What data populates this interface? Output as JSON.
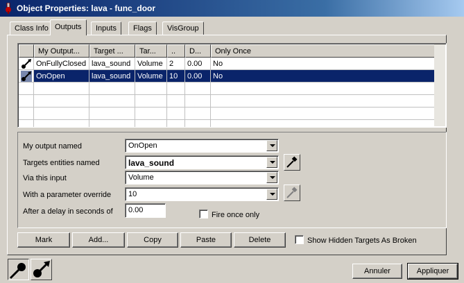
{
  "window": {
    "title": "Object Properties: lava - func_door"
  },
  "tabs": [
    {
      "label": "Class Info"
    },
    {
      "label": "Outputs",
      "active": true
    },
    {
      "label": "Inputs"
    },
    {
      "label": "Flags"
    },
    {
      "label": "VisGroup"
    }
  ],
  "grid": {
    "columns": [
      "My Output...",
      "Target ...",
      "Tar...",
      "..",
      "D...",
      "Only Once"
    ],
    "rows": [
      {
        "output": "OnFullyClosed",
        "target": "lava_sound",
        "input": "Volume",
        "param": "2",
        "delay": "0.00",
        "once": "No",
        "icon": "output-connection-icon"
      },
      {
        "output": "OnOpen",
        "target": "lava_sound",
        "input": "Volume",
        "param": "10",
        "delay": "0.00",
        "once": "No",
        "icon": "output-connection-icon",
        "selected": true
      }
    ]
  },
  "form": {
    "output_label": "My output named",
    "output_value": "OnOpen",
    "target_label": "Targets entities named",
    "target_value": "lava_sound",
    "input_label": "Via this input",
    "input_value": "Volume",
    "param_label": "With a parameter override",
    "param_value": "10",
    "delay_label": "After a delay in seconds of",
    "delay_value": "0.00",
    "fire_once_label": "Fire once only"
  },
  "buttons": {
    "mark": "Mark",
    "add": "Add...",
    "copy": "Copy",
    "paste": "Paste",
    "delete": "Delete",
    "show_hidden": "Show Hidden Targets As Broken",
    "cancel": "Annuler",
    "apply": "Appliquer"
  },
  "icons": [
    "eyedropper-icon",
    "outputs-view-icon",
    "inputs-view-icon"
  ],
  "colors": {
    "selection": "#0a246a",
    "titlebar": "#0a246a"
  }
}
